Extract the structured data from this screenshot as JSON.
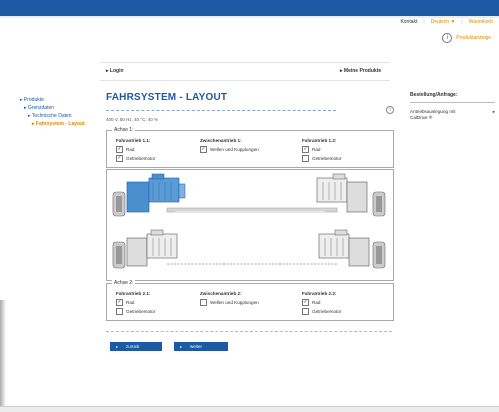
{
  "header": {
    "util_links": [
      "Kontakt",
      "Deutsch ▼",
      "Warenkorb"
    ],
    "product_info": "Produktanzeige"
  },
  "nav": {
    "login": "Login",
    "my_products": "Meine Produkte"
  },
  "breadcrumbs": [
    {
      "label": "Produkte",
      "level": 0,
      "active": false
    },
    {
      "label": "Grenzdaten",
      "level": 1,
      "active": false
    },
    {
      "label": "Technische Daten",
      "level": 2,
      "active": false
    },
    {
      "label": "Fahrsystem - Layout",
      "level": 3,
      "active": true
    }
  ],
  "page": {
    "title": "FAHRSYSTEM - LAYOUT",
    "specs": "400 V, 50 Hz, 40 °C, 40 %"
  },
  "axle1": {
    "legend": "Achse 1:",
    "columns": [
      {
        "head": "Fahrantrieb 1.1:",
        "options": [
          {
            "label": "Rad",
            "checked": true
          },
          {
            "label": "Getriebemotor",
            "checked": true
          }
        ]
      },
      {
        "head": "Zwischenantrieb 1:",
        "options": [
          {
            "label": "Wellen und Kupplungen",
            "checked": true
          }
        ]
      },
      {
        "head": "Fahrantrieb 1.2:",
        "options": [
          {
            "label": "Rad",
            "checked": true
          },
          {
            "label": "Getriebemotor",
            "checked": false
          }
        ]
      }
    ]
  },
  "axle2": {
    "legend": "Achse 2:",
    "columns": [
      {
        "head": "Fahrantrieb 2.1:",
        "options": [
          {
            "label": "Rad",
            "checked": true
          },
          {
            "label": "Getriebemotor",
            "checked": false
          }
        ]
      },
      {
        "head": "Zwischenantrieb 2:",
        "options": [
          {
            "label": "Wellen und Kupplungen",
            "checked": false
          }
        ]
      },
      {
        "head": "Fahrantrieb 2.2:",
        "options": [
          {
            "label": "Rad",
            "checked": true
          },
          {
            "label": "Getriebemotor",
            "checked": false
          }
        ]
      }
    ]
  },
  "buttons": {
    "back": "zurück",
    "next": "weiter"
  },
  "sidebar": {
    "heading": "Bestellung/Anfrage:",
    "item": "Antriebsauslegung mit CalDrive ®"
  },
  "colors": {
    "brand_blue": "#1d5aa6",
    "accent_orange": "#e08a00",
    "selected_motor": "#4c8fcf"
  }
}
